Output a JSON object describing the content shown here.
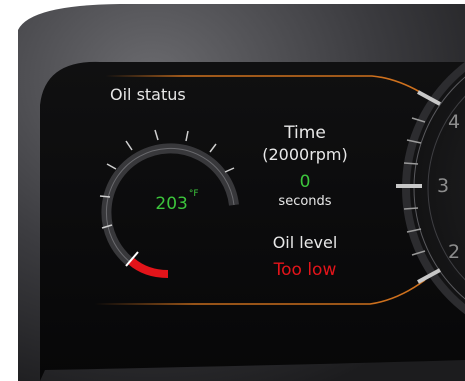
{
  "oil_status": {
    "title": "Oil status",
    "temperature": {
      "value": "203",
      "unit": "°F"
    },
    "gauge": {
      "warning_color": "#e3141a",
      "normal_color": "#3cc43c"
    }
  },
  "time": {
    "title": "Time",
    "rpm_label": "(2000rpm)",
    "value": "0",
    "unit": "seconds"
  },
  "oil_level": {
    "title": "Oil level",
    "status": "Too low",
    "status_color": "#e3141a"
  },
  "tachometer": {
    "visible_numbers": [
      "4",
      "3",
      "2"
    ]
  },
  "colors": {
    "accent_orange": "#d9761e",
    "panel_background": "#0b0b0c",
    "bezel": "#4a4a4d"
  }
}
